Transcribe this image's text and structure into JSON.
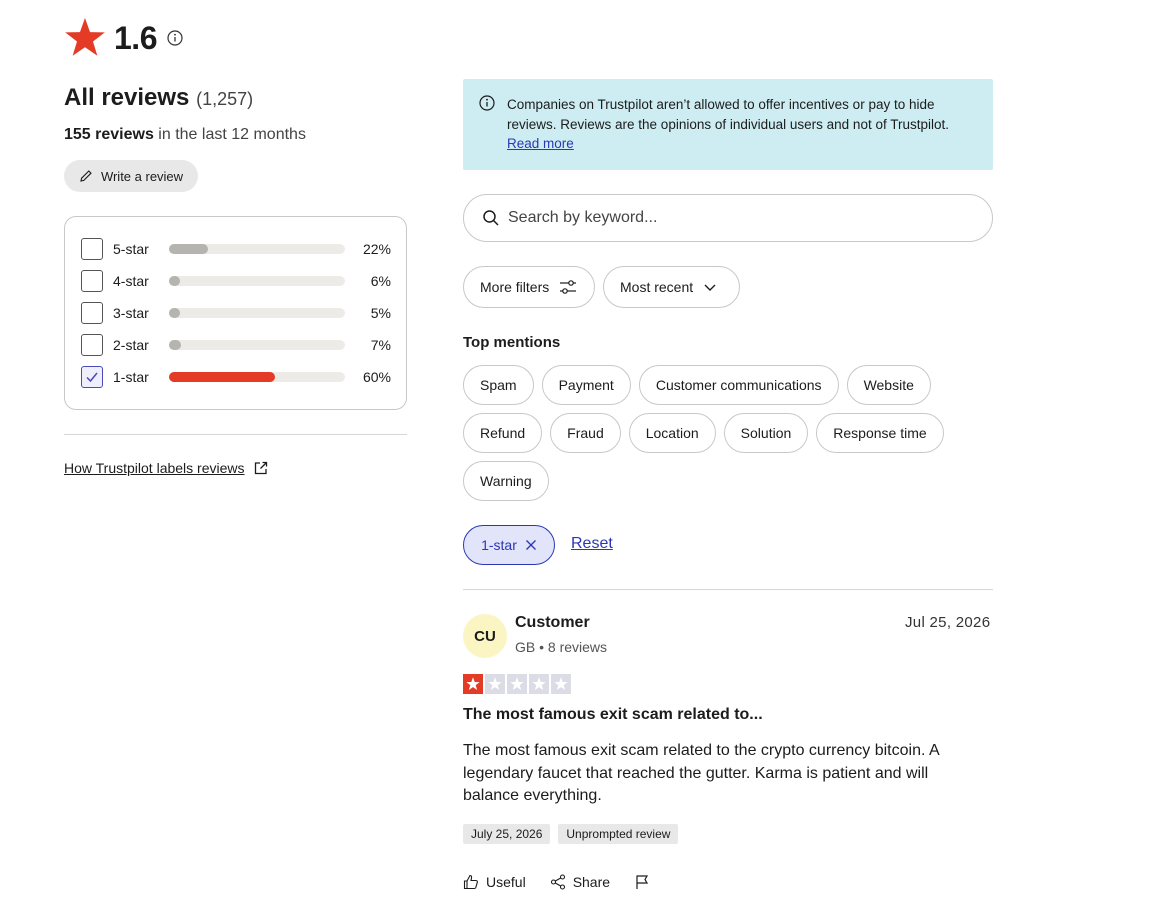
{
  "summary": {
    "rating": "1.6",
    "all_reviews_label": "All reviews",
    "total_count": "(1,257)",
    "recent_count": "155 reviews",
    "recent_period": " in the last 12 months",
    "write_review_label": "Write a review",
    "labels_link": "How Trustpilot labels reviews"
  },
  "distribution": [
    {
      "label": "5-star",
      "percent": "22%",
      "fraction": 0.22,
      "checked": false
    },
    {
      "label": "4-star",
      "percent": "6%",
      "fraction": 0.06,
      "checked": false
    },
    {
      "label": "3-star",
      "percent": "5%",
      "fraction": 0.05,
      "checked": false
    },
    {
      "label": "2-star",
      "percent": "7%",
      "fraction": 0.07,
      "checked": false
    },
    {
      "label": "1-star",
      "percent": "60%",
      "fraction": 0.6,
      "checked": true
    }
  ],
  "notice": {
    "text": "Companies on Trustpilot aren’t allowed to offer incentives or pay to hide reviews. Reviews are the opinions of individual users and not of Trustpilot. ",
    "link": "Read more"
  },
  "search": {
    "placeholder": "Search by keyword..."
  },
  "controls": {
    "more_filters": "More filters",
    "sort": "Most recent"
  },
  "top_mentions": {
    "title": "Top mentions",
    "chips": [
      "Spam",
      "Payment",
      "Customer communications",
      "Website",
      "Refund",
      "Fraud",
      "Location",
      "Solution",
      "Response time",
      "Warning"
    ]
  },
  "active_filter": {
    "label": "1-star",
    "reset": "Reset"
  },
  "review": {
    "initials": "CU",
    "name": "Customer",
    "meta": "GB • 8 reviews",
    "date": "Jul 25, 2026",
    "stars": 1,
    "title": "The most famous exit scam related to...",
    "body": "The most famous exit scam related to the crypto currency bitcoin. A legendary faucet that reached the gutter. Karma is patient and will balance everything.",
    "tags": [
      "July 25, 2026",
      "Unprompted review"
    ],
    "useful": "Useful",
    "share": "Share"
  },
  "colors": {
    "accent_red": "#e33b26",
    "link_blue": "#2b37b5",
    "notice_bg": "#cdedf3"
  }
}
